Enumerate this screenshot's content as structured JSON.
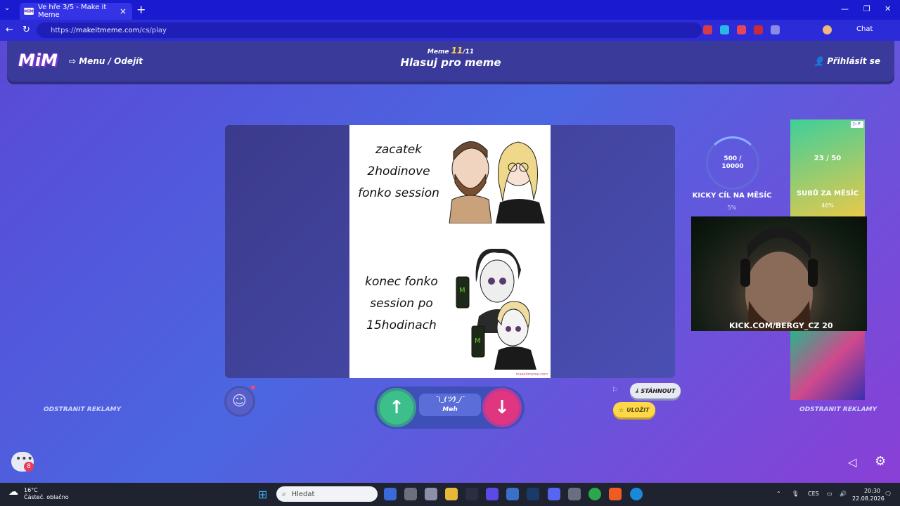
{
  "browser": {
    "tab_title": "Ve hře 3/5 - Make it Meme",
    "tab_favicon": "MiM",
    "url_prefix": "https://",
    "url_host": "makeitmeme.com",
    "url_path": "/cs/play",
    "chat_label": "Chat"
  },
  "header": {
    "logo": "MiM",
    "menu_label": "Menu / Odejít",
    "meme_prefix": "Meme",
    "meme_current": "11",
    "meme_total": "/11",
    "title": "Hlasuj pro meme",
    "login_label": "Přihlásit se"
  },
  "meme": {
    "top_text": [
      "zacatek",
      "2hodinove",
      "fonko session"
    ],
    "bottom_text": [
      "konec fonko",
      "session po",
      "15hodinach"
    ],
    "watermark": "makeitmeme.com"
  },
  "voting": {
    "meh_face": "¯\\_(ツ)_/¯",
    "meh_label": "Meh"
  },
  "actions": {
    "download_label": "STÁHNOUT",
    "save_label": "ULOŽIT"
  },
  "ads": {
    "remove_left": "ODSTRANIT REKLAMY",
    "remove_right": "ODSTRANIT REKLAMY",
    "goal_value": "500 /",
    "goal_total": "10000",
    "goal_label": "KICKY CÍL NA MĚSÍC",
    "goal_percent": "5%",
    "goal_progress": 0.05,
    "ad_count": "23 / 50",
    "ad_title": "SUBŮ ZA MĚSÍC",
    "ad_percent": "46%",
    "webcam_caption": "KICK.COM/BERGY_CZ 20"
  },
  "chat_badge": "8",
  "taskbar": {
    "temp": "16°C",
    "weather": "Částeč. oblačno",
    "search_placeholder": "Hledat",
    "lang": "CES",
    "time": "20:30",
    "date": "22.08.2026"
  },
  "colors": {
    "up": "#3cbf8a",
    "down": "#e0357f",
    "save_bg": "#ffd84a",
    "accent": "#7c3bd0"
  }
}
